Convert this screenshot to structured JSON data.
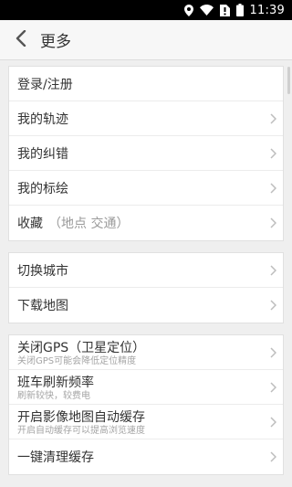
{
  "status_bar": {
    "time": "11:39",
    "icons": [
      "location-icon",
      "wifi-icon",
      "sim-no-signal-icon",
      "battery-icon"
    ]
  },
  "header": {
    "back_icon": "chevron-left-icon",
    "title": "更多"
  },
  "section1": [
    {
      "label": "登录/注册",
      "chevron": false
    },
    {
      "label": "我的轨迹",
      "chevron": true
    },
    {
      "label": "我的纠错",
      "chevron": true
    },
    {
      "label": "我的标绘",
      "chevron": true
    },
    {
      "label": "收藏",
      "hint": "（地点 交通）",
      "chevron": true
    }
  ],
  "section2": [
    {
      "label": "切换城市"
    },
    {
      "label": "下载地图"
    }
  ],
  "section3": [
    {
      "label": "关闭GPS（卫星定位）",
      "sub": "关闭GPS可能会降低定位精度"
    },
    {
      "label": "班车刷新频率",
      "sub": "刷新较快，较费电"
    },
    {
      "label": "开启影像地图自动缓存",
      "sub": "开启自动缓存可以提高浏览速度"
    },
    {
      "label": "一键清理缓存"
    }
  ],
  "colors": {
    "status_bar": "#000000",
    "nav_bar": "#f7f7f7",
    "background": "#efefef",
    "text": "#333333",
    "subtext": "#a5a5a5"
  }
}
